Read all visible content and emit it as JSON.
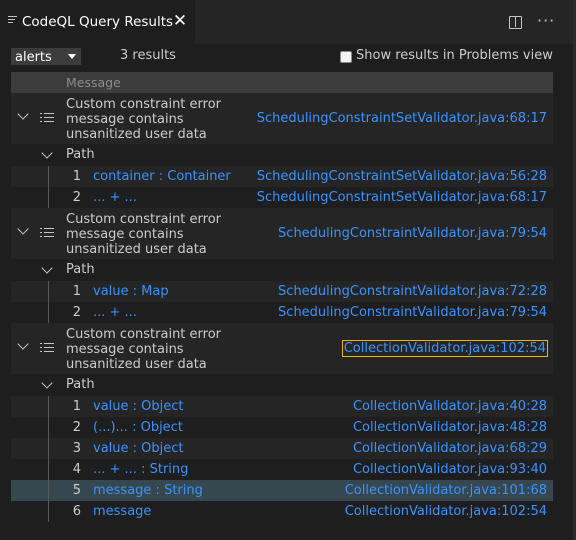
{
  "tab": {
    "title": "CodeQL Query Results",
    "close": "✕"
  },
  "toolbar": {
    "select_value": "alerts",
    "result_count": "3 results",
    "checkbox_label": "Show results in Problems view",
    "checkbox_checked": false
  },
  "table": {
    "header": "Message",
    "results": [
      {
        "message": "Custom constraint error\nmessage contains\nunsanitized user data",
        "location": "SchedulingConstraintSetValidator.java:68:17",
        "path_label": "Path",
        "steps": [
          {
            "n": "1",
            "text": "container : Container",
            "loc": "SchedulingConstraintSetValidator.java:56:28"
          },
          {
            "n": "2",
            "text": "... + ...",
            "loc": "SchedulingConstraintSetValidator.java:68:17"
          }
        ]
      },
      {
        "message": "Custom constraint error\nmessage contains\nunsanitized user data",
        "location": "SchedulingConstraintValidator.java:79:54",
        "path_label": "Path",
        "steps": [
          {
            "n": "1",
            "text": "value : Map",
            "loc": "SchedulingConstraintValidator.java:72:28"
          },
          {
            "n": "2",
            "text": "... + ...",
            "loc": "SchedulingConstraintValidator.java:79:54"
          }
        ]
      },
      {
        "message": "Custom constraint error\nmessage contains\nunsanitized user data",
        "location": "CollectionValidator.java:102:54",
        "path_label": "Path",
        "steps": [
          {
            "n": "1",
            "text": "value : Object",
            "loc": "CollectionValidator.java:40:28"
          },
          {
            "n": "2",
            "text": "(...)... : Object",
            "loc": "CollectionValidator.java:48:28"
          },
          {
            "n": "3",
            "text": "value : Object",
            "loc": "CollectionValidator.java:68:29"
          },
          {
            "n": "4",
            "text": "... + ... : String",
            "loc": "CollectionValidator.java:93:40"
          },
          {
            "n": "5",
            "text": "message : String",
            "loc": "CollectionValidator.java:101:68"
          },
          {
            "n": "6",
            "text": "message",
            "loc": "CollectionValidator.java:102:54"
          }
        ]
      }
    ]
  },
  "selected_step": {
    "result": 3,
    "step": 5
  },
  "colors": {
    "link": "#3794ff",
    "selected_row": "#37474f",
    "focus_outline": "#f0b400"
  }
}
